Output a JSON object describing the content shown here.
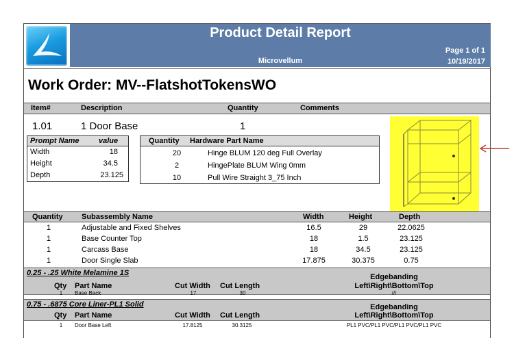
{
  "header": {
    "title": "Product Detail Report",
    "company": "Microvellum",
    "page": "Page 1 of 1",
    "date": "10/19/2017"
  },
  "work_order": "Work Order: MV--FlatshotTokensWO",
  "product_columns": {
    "item": "Item#",
    "description": "Description",
    "quantity": "Quantity",
    "comments": "Comments"
  },
  "product": {
    "item": "1.01",
    "description": "1 Door Base",
    "quantity": "1"
  },
  "prompts": {
    "headers": {
      "name": "Prompt Name",
      "value": "value"
    },
    "rows": [
      {
        "name": "Width",
        "value": "18"
      },
      {
        "name": "Height",
        "value": "34.5"
      },
      {
        "name": "Depth",
        "value": "23.125"
      }
    ]
  },
  "hardware": {
    "headers": {
      "quantity": "Quantity",
      "name": "Hardware Part Name"
    },
    "rows": [
      {
        "quantity": "20",
        "name": "Hinge BLUM 120 deg Full Overlay"
      },
      {
        "quantity": "2",
        "name": "HingePlate BLUM Wing 0mm"
      },
      {
        "quantity": "10",
        "name": "Pull Wire Straight 3_75 Inch"
      }
    ]
  },
  "subassemblies": {
    "headers": {
      "quantity": "Quantity",
      "name": "Subassembly Name",
      "width": "Width",
      "height": "Height",
      "depth": "Depth"
    },
    "rows": [
      {
        "quantity": "1",
        "name": "Adjustable and Fixed Shelves",
        "width": "16.5",
        "height": "29",
        "depth": "22.0625"
      },
      {
        "quantity": "1",
        "name": "Base Counter Top",
        "width": "18",
        "height": "1.5",
        "depth": "23.125"
      },
      {
        "quantity": "1",
        "name": "Carcass Base",
        "width": "18",
        "height": "34.5",
        "depth": "23.125"
      },
      {
        "quantity": "1",
        "name": "Door Single Slab",
        "width": "17.875",
        "height": "30.375",
        "depth": "0.75"
      }
    ]
  },
  "materials": [
    {
      "name": "0.25 - .25 White Melamine 1S",
      "headers": {
        "qty": "Qty",
        "part": "Part Name",
        "cut_width": "Cut Width",
        "cut_length": "Cut Length",
        "edge1": "Edgebanding",
        "edge2": "Left\\Right\\Bottom\\Top"
      },
      "rows": [
        {
          "qty": "1",
          "part": "Base Back",
          "cut_width": "17",
          "cut_length": "30",
          "edge": "///"
        }
      ]
    },
    {
      "name": "0.75 - .6875 Core Liner-PL1 Solid",
      "headers": {
        "qty": "Qty",
        "part": "Part Name",
        "cut_width": "Cut Width",
        "cut_length": "Cut Length",
        "edge1": "Edgebanding",
        "edge2": "Left\\Right\\Bottom\\Top"
      },
      "rows": [
        {
          "qty": "1",
          "part": "Door Base Left",
          "cut_width": "17.8125",
          "cut_length": "30.3125",
          "edge": "PL1 PVC/PL1 PVC/PL1 PVC/PL1 PVC"
        }
      ]
    }
  ],
  "colors": {
    "header_band": "#5d7da8",
    "section_band": "#c8c8c8",
    "image_highlight": "#ffff33",
    "annotation_arrow": "#c0392b"
  }
}
